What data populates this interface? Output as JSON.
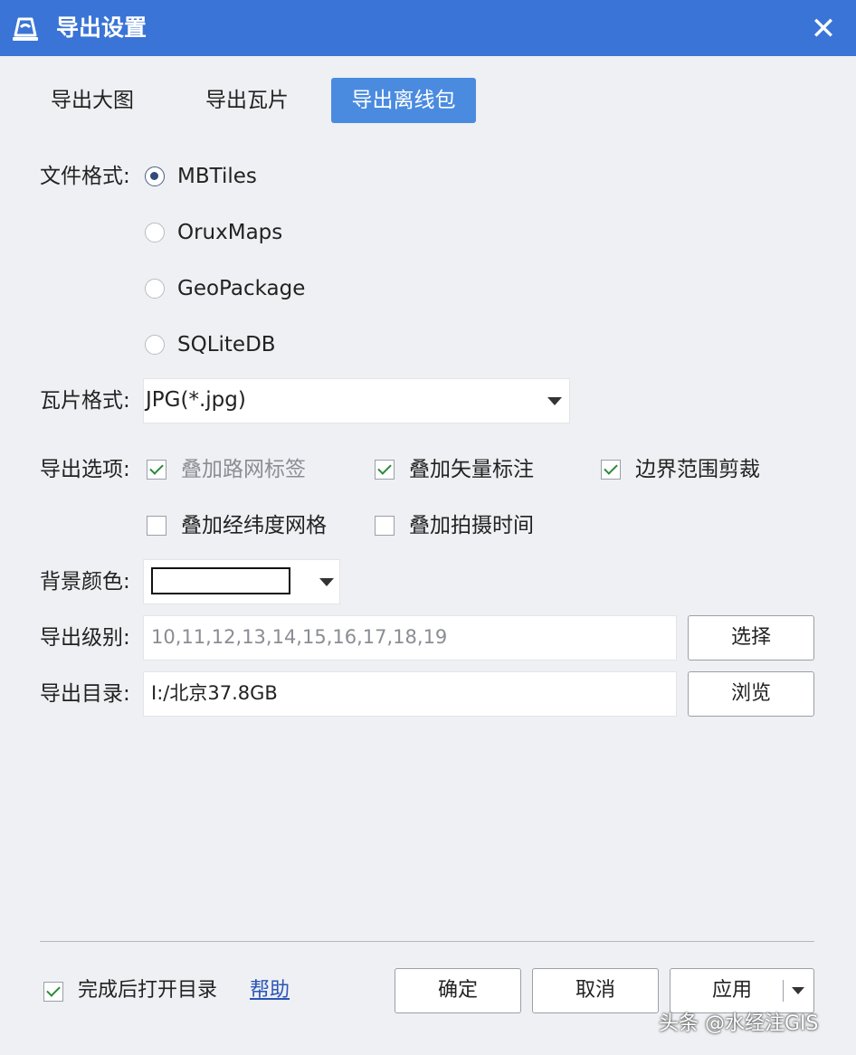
{
  "window": {
    "title": "导出设置",
    "close_symbol": "✕"
  },
  "tabs": [
    {
      "label": "导出大图",
      "active": false
    },
    {
      "label": "导出瓦片",
      "active": false
    },
    {
      "label": "导出离线包",
      "active": true
    }
  ],
  "file_format": {
    "label": "文件格式:",
    "options": [
      {
        "label": "MBTiles",
        "checked": true
      },
      {
        "label": "OruxMaps",
        "checked": false
      },
      {
        "label": "GeoPackage",
        "checked": false
      },
      {
        "label": "SQLiteDB",
        "checked": false
      }
    ]
  },
  "tile_format": {
    "label": "瓦片格式:",
    "value": "JPG(*.jpg)"
  },
  "export_options": {
    "label": "导出选项:",
    "items": [
      {
        "label": "叠加路网标签",
        "checked": true,
        "enabled": false
      },
      {
        "label": "叠加矢量标注",
        "checked": true,
        "enabled": true
      },
      {
        "label": "边界范围剪裁",
        "checked": true,
        "enabled": true
      },
      {
        "label": "叠加经纬度网格",
        "checked": false,
        "enabled": true
      },
      {
        "label": "叠加拍摄时间",
        "checked": false,
        "enabled": true
      }
    ]
  },
  "background_color": {
    "label": "背景颜色:",
    "value": "#ffffff"
  },
  "export_levels": {
    "label": "导出级别:",
    "value": "10,11,12,13,14,15,16,17,18,19",
    "button": "选择"
  },
  "export_dir": {
    "label": "导出目录:",
    "value": "I:/北京37.8GB",
    "button": "浏览"
  },
  "footer": {
    "open_dir_label": "完成后打开目录",
    "open_dir_checked": true,
    "help_link": "帮助",
    "ok_button": "确定",
    "cancel_button": "取消",
    "apply_button": "应用"
  },
  "watermark": "头条 @水经注GIS",
  "colors": {
    "title_bar": "#3a74d6",
    "active_tab": "#4a8be0",
    "background": "#eef0f3",
    "check_mark": "#2a8a3a",
    "link": "#2a55b8"
  }
}
